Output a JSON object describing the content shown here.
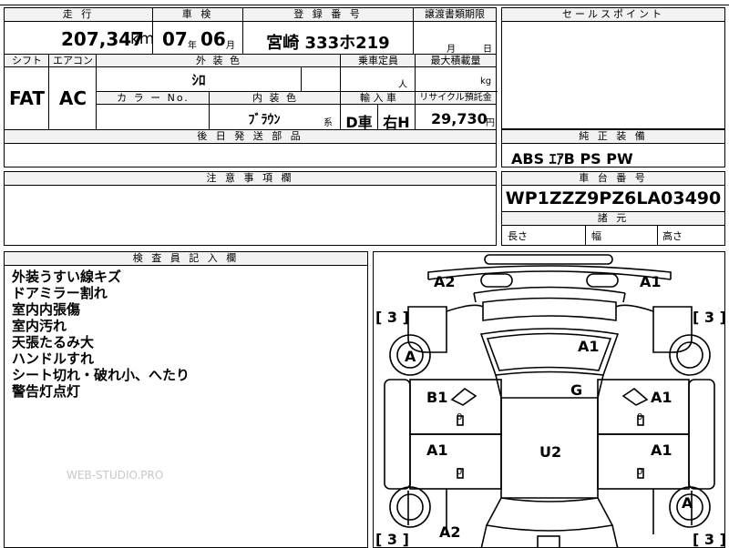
{
  "top": {
    "mileage": {
      "label": "走 行",
      "value": "207,347",
      "unit": "km"
    },
    "inspection": {
      "label": "車 検",
      "year": "07",
      "year_unit": "年",
      "month": "06",
      "month_unit": "月"
    },
    "registration": {
      "label": "登 録 番 号",
      "value": "宮崎 333ホ219"
    },
    "transfer_deadline": {
      "label": "譲渡書類期限",
      "month_unit": "月",
      "day_unit": "日"
    },
    "sales_point": {
      "label": "セールスポイント"
    }
  },
  "specs": {
    "shift": {
      "label": "シフト",
      "value": "FAT"
    },
    "aircon": {
      "label": "エアコン",
      "value": "AC"
    },
    "exterior_color": {
      "label": "外 装 色",
      "value": "ｼﾛ"
    },
    "capacity": {
      "label": "乗車定員",
      "unit": "人"
    },
    "max_load": {
      "label": "最大積載量",
      "unit": "kg"
    },
    "color_no": {
      "label": "カ ラ ー No."
    },
    "interior_color": {
      "label": "内 装 色",
      "value": "ﾌﾞﾗｳﾝ",
      "unit": "系"
    },
    "import": {
      "label": "輸 入 車",
      "value1": "D車",
      "value2": "右H"
    },
    "recycle": {
      "label": "リサイクル預託金",
      "value": "29,730",
      "unit": "円"
    },
    "later_parts": {
      "label": "後 日 発 送 部 品"
    }
  },
  "equipment": {
    "label": "純 正 装 備",
    "value": "ABS ｴｱB PS PW"
  },
  "notes": {
    "label": "注 意 事 項 欄"
  },
  "chassis": {
    "label": "車 台 番 号",
    "value": "WP1ZZZ9PZ6LA03490"
  },
  "dimensions": {
    "label": "諸 元",
    "length": "長さ",
    "width": "幅",
    "height": "高さ"
  },
  "inspector": {
    "label": "検 査 員 記 入 欄",
    "lines": [
      "外装うすい線キズ",
      "ドアミラー割れ",
      "室内内張傷",
      "室内汚れ",
      "天張たるみ大",
      "ハンドルすれ",
      "シート切れ・破れ小、へたり",
      "警告灯点灯"
    ],
    "watermark": "WEB-STUDIO.PRO"
  },
  "diagram": {
    "marks": {
      "front_left": "A2",
      "front_right": "A1",
      "hood": "A1",
      "left_front_wheel": "A",
      "rear_right_wheel": "A",
      "windshield": "G",
      "left_front_door": "B1",
      "right_front_door": "A1",
      "left_rear_door": "A1",
      "right_rear_door": "A1",
      "roof": "U2",
      "rear_left": "A2"
    },
    "tire_depth": {
      "fl": "[ 3 ]",
      "fr": "[ 3 ]",
      "rl": "[ 3 ]",
      "rr": "[ 3 ]"
    },
    "zero": "0"
  }
}
